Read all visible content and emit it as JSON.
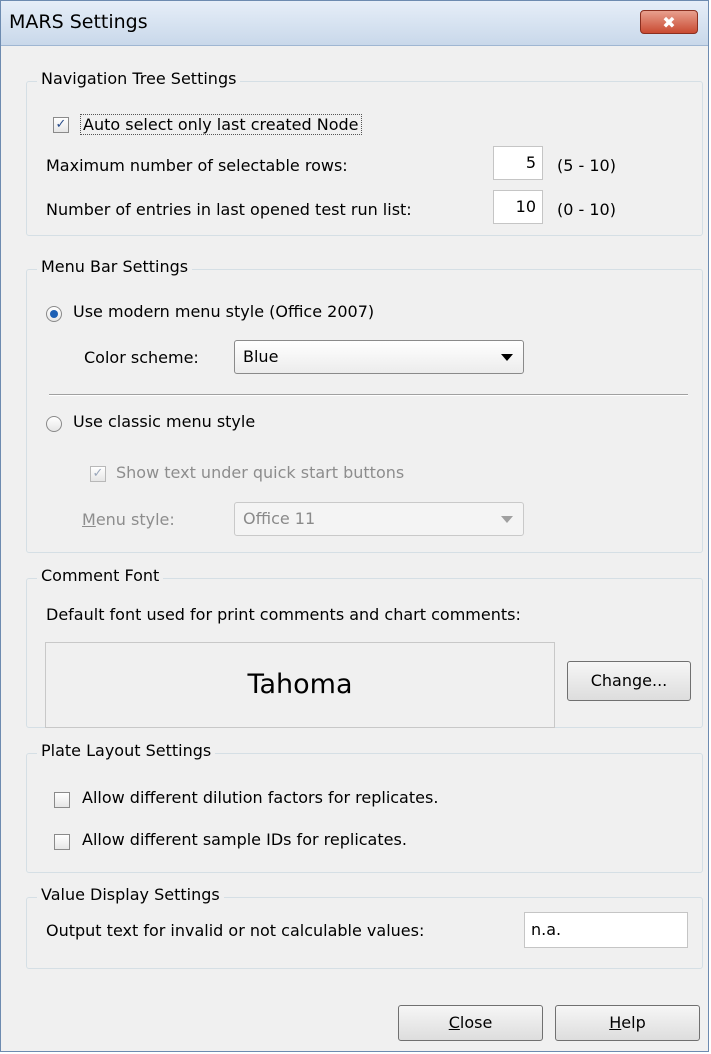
{
  "window": {
    "title": "MARS Settings",
    "close_glyph": "✖"
  },
  "navigation": {
    "title": "Navigation Tree Settings",
    "auto_select_label": "Auto select only last created Node",
    "auto_select_checked": true,
    "max_rows_label": "Maximum number of selectable rows:",
    "max_rows_value": "5",
    "max_rows_range": "(5 - 10)",
    "entries_label": "Number of entries in last opened test run list:",
    "entries_value": "10",
    "entries_range": "(0 - 10)"
  },
  "menubar": {
    "title": "Menu Bar Settings",
    "modern_label": "Use modern menu style (Office 2007)",
    "modern_selected": true,
    "color_scheme_label": "Color scheme:",
    "color_scheme_value": "Blue",
    "classic_label": "Use classic menu style",
    "show_text_label": "Show text under quick start buttons",
    "menu_style_label_prefix": "M",
    "menu_style_label_rest": "enu style:",
    "menu_style_value": "Office 11"
  },
  "comment_font": {
    "title": "Comment Font",
    "description": "Default font used for print comments and chart comments:",
    "font_name": "Tahoma",
    "change_label": "Change..."
  },
  "plate_layout": {
    "title": "Plate Layout Settings",
    "dilution_label": "Allow different dilution factors for replicates.",
    "sample_ids_label": "Allow different sample IDs for replicates."
  },
  "value_display": {
    "title": "Value Display Settings",
    "output_label": "Output text for invalid or not calculable values:",
    "output_value": "n.a."
  },
  "footer": {
    "close_prefix": "C",
    "close_rest": "lose",
    "help_prefix": "H",
    "help_rest": "elp"
  },
  "check_glyph": "✓",
  "colors": {
    "accent": "#1c5fb4",
    "close_button": "#c94a32"
  }
}
